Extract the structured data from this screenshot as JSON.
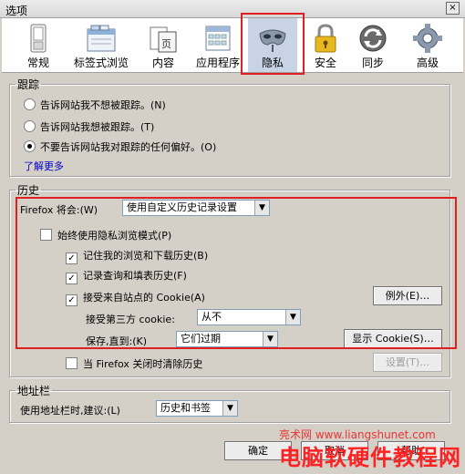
{
  "window": {
    "title": "选项",
    "close_glyph": "×"
  },
  "tabs": [
    {
      "label": "常规",
      "icon": "switch-icon"
    },
    {
      "label": "标签式浏览",
      "icon": "tabs-window-icon"
    },
    {
      "label": "内容",
      "icon": "page-icon"
    },
    {
      "label": "应用程序",
      "icon": "applications-icon"
    },
    {
      "label": "隐私",
      "icon": "mask-icon"
    },
    {
      "label": "安全",
      "icon": "padlock-icon"
    },
    {
      "label": "同步",
      "icon": "sync-icon"
    },
    {
      "label": "高级",
      "icon": "gear-icon"
    }
  ],
  "tracking": {
    "legend": "跟踪",
    "options": [
      "告诉网站我不想被跟踪。(N)",
      "告诉网站我想被跟踪。(T)",
      "不要告诉网站我对跟踪的任何偏好。(O)"
    ],
    "selected_index": 2,
    "learn_more": "了解更多"
  },
  "history": {
    "legend": "历史",
    "will_label": "Firefox 将会:(W)",
    "mode_value": "使用自定义历史记录设置",
    "private_mode": "始终使用隐私浏览模式(P)",
    "remember_history": "记住我的浏览和下载历史(B)",
    "remember_forms": "记录查询和填表历史(F)",
    "accept_cookies": "接受来自站点的 Cookie(A)",
    "exceptions_button": "例外(E)…",
    "third_party_label": "接受第三方 cookie:",
    "third_party_value": "从不",
    "keep_until_label": "保存,直到:(K)",
    "keep_until_value": "它们过期",
    "show_cookies_button": "显示 Cookie(S)…",
    "clear_on_close": "当 Firefox 关闭时清除历史",
    "settings_button": "设置(T)…"
  },
  "address_bar": {
    "legend": "地址栏",
    "suggest_label": "使用地址栏时,建议:(L)",
    "suggest_value": "历史和书签"
  },
  "footer": {
    "ok_button": "确定",
    "cancel_button": "取消",
    "help_button": "帮助"
  },
  "watermark": {
    "line1": "亮术网 www.liangshunet.com",
    "line2": "电脑软硬件教程网"
  },
  "colors": {
    "highlight": "#e02020",
    "link": "#0000cc",
    "watermark": "#ff2222"
  }
}
